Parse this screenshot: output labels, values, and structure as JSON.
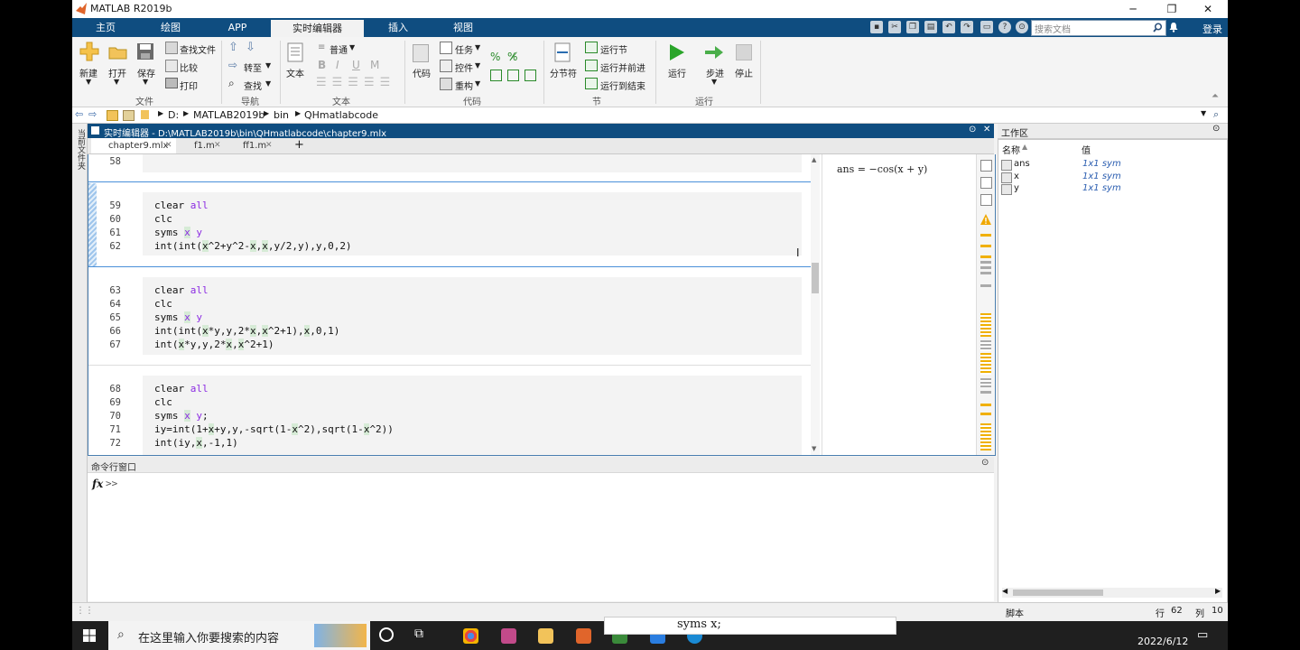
{
  "window": {
    "title": "MATLAB R2019b"
  },
  "ribbon_tabs": [
    "主页",
    "绘图",
    "APP",
    "实时编辑器",
    "插入",
    "视图"
  ],
  "search": {
    "placeholder": "搜索文档"
  },
  "login": "登录",
  "toolstrip": {
    "new": "新建",
    "open": "打开",
    "save": "保存",
    "find_files": "查找文件",
    "compare": "比较",
    "print": "打印",
    "goto": "转至",
    "find": "查找",
    "text": "文本",
    "normal": "普通",
    "code": "代码",
    "task": "任务",
    "control": "控件",
    "refactor": "重构",
    "section_break": "分节符",
    "run_section": "运行节",
    "run_advance": "运行并前进",
    "run_to_end": "运行到结束",
    "run": "运行",
    "step": "步进",
    "stop": "停止",
    "sections": {
      "file": "文件",
      "nav": "导航",
      "text": "文本",
      "code": "代码",
      "section": "节",
      "run": "运行"
    }
  },
  "path": [
    "D:",
    "MATLAB2019b",
    "bin",
    "QHmatlabcode"
  ],
  "left_panel_label": "当前文件夹",
  "editor": {
    "title": "实时编辑器 - D:\\MATLAB2019b\\bin\\QHmatlabcode\\chapter9.mlx",
    "tabs": [
      "chapter9.mlx",
      "f1.m",
      "ff1.m"
    ],
    "output": "ans = −cos(x + y)"
  },
  "code_lines": [
    {
      "n": "58",
      "text": ""
    },
    {
      "n": "59",
      "text": "clear all"
    },
    {
      "n": "60",
      "text": "clc"
    },
    {
      "n": "61",
      "text": "syms x y"
    },
    {
      "n": "62",
      "text": "int(int(x^2+y^2-x,x,y/2,y),y,0,2)"
    },
    {
      "n": "63",
      "text": "clear all"
    },
    {
      "n": "64",
      "text": "clc"
    },
    {
      "n": "65",
      "text": "syms x y"
    },
    {
      "n": "66",
      "text": "int(int(x*y,y,2*x,x^2+1),x,0,1)"
    },
    {
      "n": "67",
      "text": "int(x*y,y,2*x,x^2+1)"
    },
    {
      "n": "68",
      "text": "clear all"
    },
    {
      "n": "69",
      "text": "clc"
    },
    {
      "n": "70",
      "text": "syms x y;"
    },
    {
      "n": "71",
      "text": "iy=int(1+x+y,y,-sqrt(1-x^2),sqrt(1-x^2))"
    },
    {
      "n": "72",
      "text": "int(iy,x,-1,1)"
    }
  ],
  "command_window": {
    "title": "命令行窗口",
    "prompt": ">>",
    "fx": "fx"
  },
  "workspace": {
    "title": "工作区",
    "col_name": "名称",
    "col_value": "值",
    "rows": [
      {
        "name": "ans",
        "value": "1x1 sym"
      },
      {
        "name": "x",
        "value": "1x1 sym"
      },
      {
        "name": "y",
        "value": "1x1 sym"
      }
    ]
  },
  "status": {
    "mode": "脚本",
    "row_label": "行",
    "row": "62",
    "col_label": "列",
    "col": "10"
  },
  "taskbar": {
    "search_placeholder": "在这里输入你要搜索的内容",
    "date": "2022/6/12"
  },
  "popup_text": "syms x;"
}
